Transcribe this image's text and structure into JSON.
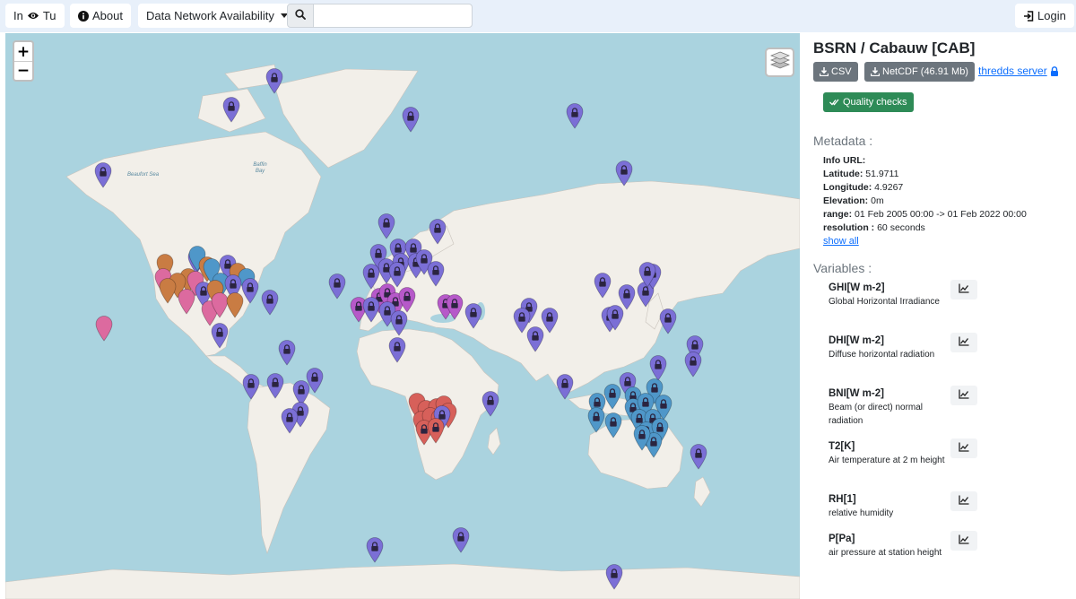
{
  "nav": {
    "logo_prefix": "In",
    "logo_suffix": "Tu",
    "about_label": "About",
    "dropdown_label": "Data Network Availability",
    "search_placeholder": "",
    "login_label": "Login"
  },
  "map": {
    "zoom_in": "+",
    "zoom_out": "−",
    "labels": {
      "beaufort": "Beaufort Sea",
      "baffin": "Baffin Bay"
    },
    "marker_colors": {
      "purple": "#7b6fd6",
      "orange": "#c97c43",
      "pink": "#dc6a9f",
      "blue": "#4f97c9",
      "magenta": "#b659c9",
      "red": "#d7605a"
    },
    "markers": [
      [
        "purple",
        306,
        90,
        true
      ],
      [
        "purple",
        258,
        122,
        true
      ],
      [
        "purple",
        458,
        133,
        true
      ],
      [
        "purple",
        641,
        129,
        true
      ],
      [
        "purple",
        115,
        195,
        true
      ],
      [
        "purple",
        696,
        193,
        true
      ],
      [
        "purple",
        431,
        252,
        true
      ],
      [
        "purple",
        488,
        258,
        true
      ],
      [
        "orange",
        184,
        297,
        false
      ],
      [
        "purple",
        219,
        291,
        true
      ],
      [
        "blue",
        220,
        288,
        false
      ],
      [
        "purple",
        254,
        298,
        true
      ],
      [
        "orange",
        231,
        300,
        false
      ],
      [
        "blue",
        236,
        302,
        false
      ],
      [
        "orange",
        265,
        307,
        false
      ],
      [
        "blue",
        275,
        313,
        false
      ],
      [
        "orange",
        210,
        313,
        false
      ],
      [
        "pink",
        182,
        313,
        false
      ],
      [
        "orange",
        198,
        318,
        false
      ],
      [
        "pink",
        218,
        316,
        false
      ],
      [
        "blue",
        246,
        318,
        false
      ],
      [
        "purple",
        260,
        320,
        true
      ],
      [
        "orange",
        187,
        324,
        false
      ],
      [
        "pink",
        208,
        336,
        false
      ],
      [
        "purple",
        227,
        328,
        true
      ],
      [
        "orange",
        240,
        326,
        false
      ],
      [
        "purple",
        279,
        324,
        true
      ],
      [
        "purple",
        301,
        337,
        true
      ],
      [
        "pink",
        234,
        349,
        false
      ],
      [
        "pink",
        245,
        340,
        false
      ],
      [
        "orange",
        262,
        340,
        false
      ],
      [
        "pink",
        116,
        366,
        false
      ],
      [
        "purple",
        245,
        374,
        true
      ],
      [
        "purple",
        376,
        319,
        true
      ],
      [
        "purple",
        422,
        286,
        true
      ],
      [
        "purple",
        444,
        280,
        true
      ],
      [
        "purple",
        461,
        280,
        true
      ],
      [
        "purple",
        431,
        302,
        true
      ],
      [
        "purple",
        447,
        296,
        true
      ],
      [
        "purple",
        464,
        296,
        true
      ],
      [
        "purple",
        473,
        292,
        true
      ],
      [
        "purple",
        486,
        305,
        true
      ],
      [
        "purple",
        443,
        306,
        true
      ],
      [
        "purple",
        414,
        308,
        true
      ],
      [
        "magenta",
        423,
        335,
        true
      ],
      [
        "magenta",
        432,
        330,
        true
      ],
      [
        "magenta",
        441,
        340,
        true
      ],
      [
        "magenta",
        454,
        334,
        true
      ],
      [
        "magenta",
        400,
        345,
        true
      ],
      [
        "purple",
        414,
        345,
        true
      ],
      [
        "purple",
        432,
        350,
        true
      ],
      [
        "magenta",
        497,
        342,
        true
      ],
      [
        "magenta",
        507,
        342,
        true
      ],
      [
        "purple",
        528,
        352,
        true
      ],
      [
        "purple",
        445,
        360,
        true
      ],
      [
        "purple",
        443,
        390,
        true
      ],
      [
        "purple",
        590,
        346,
        true
      ],
      [
        "purple",
        582,
        357,
        true
      ],
      [
        "purple",
        613,
        357,
        true
      ],
      [
        "purple",
        597,
        378,
        true
      ],
      [
        "purple",
        672,
        318,
        true
      ],
      [
        "purple",
        699,
        331,
        true
      ],
      [
        "purple",
        720,
        328,
        true
      ],
      [
        "purple",
        728,
        308,
        true
      ],
      [
        "purple",
        722,
        306,
        true
      ],
      [
        "purple",
        680,
        356,
        true
      ],
      [
        "purple",
        686,
        354,
        true
      ],
      [
        "purple",
        745,
        358,
        true
      ],
      [
        "purple",
        775,
        388,
        true
      ],
      [
        "purple",
        773,
        406,
        true
      ],
      [
        "purple",
        734,
        410,
        true
      ],
      [
        "purple",
        320,
        393,
        true
      ],
      [
        "purple",
        351,
        424,
        true
      ],
      [
        "purple",
        280,
        431,
        true
      ],
      [
        "purple",
        307,
        430,
        true
      ],
      [
        "purple",
        336,
        438,
        true
      ],
      [
        "purple",
        335,
        462,
        true
      ],
      [
        "purple",
        323,
        469,
        true
      ],
      [
        "red",
        465,
        452,
        false
      ],
      [
        "red",
        475,
        460,
        false
      ],
      [
        "red",
        487,
        458,
        false
      ],
      [
        "red",
        495,
        455,
        false
      ],
      [
        "red",
        470,
        472,
        false
      ],
      [
        "red",
        480,
        468,
        false
      ],
      [
        "red",
        490,
        470,
        false
      ],
      [
        "red",
        500,
        463,
        false
      ],
      [
        "purple",
        493,
        466,
        true
      ],
      [
        "red",
        473,
        482,
        true
      ],
      [
        "red",
        486,
        480,
        true
      ],
      [
        "purple",
        547,
        450,
        true
      ],
      [
        "purple",
        630,
        431,
        true
      ],
      [
        "blue",
        666,
        452,
        true
      ],
      [
        "blue",
        683,
        442,
        true
      ],
      [
        "purple",
        700,
        429,
        true
      ],
      [
        "blue",
        706,
        445,
        true
      ],
      [
        "blue",
        730,
        436,
        true
      ],
      [
        "blue",
        665,
        468,
        true
      ],
      [
        "blue",
        684,
        474,
        true
      ],
      [
        "blue",
        706,
        458,
        true
      ],
      [
        "blue",
        720,
        452,
        true
      ],
      [
        "blue",
        740,
        454,
        true
      ],
      [
        "blue",
        713,
        470,
        true
      ],
      [
        "blue",
        728,
        470,
        true
      ],
      [
        "blue",
        721,
        484,
        true
      ],
      [
        "blue",
        736,
        480,
        true
      ],
      [
        "blue",
        729,
        496,
        true
      ],
      [
        "blue",
        716,
        488,
        true
      ],
      [
        "purple",
        779,
        509,
        true
      ],
      [
        "purple",
        418,
        613,
        true
      ],
      [
        "purple",
        514,
        602,
        true
      ],
      [
        "purple",
        685,
        643,
        true
      ]
    ]
  },
  "panel": {
    "station_title": "BSRN / Cabauw [CAB]",
    "csv_label": "CSV",
    "netcdf_label": "NetCDF (46.91 Mb)",
    "thredds_label": "thredds server",
    "quality_label": "Quality checks",
    "metadata_heading": "Metadata :",
    "meta": {
      "info_url_label": "Info URL:",
      "latitude_label": "Latitude:",
      "latitude": "51.9711",
      "longitude_label": "Longitude:",
      "longitude": "4.9267",
      "elevation_label": "Elevation:",
      "elevation": "0m",
      "range_label": "range:",
      "range": "01 Feb 2005 00:00 -> 01 Feb 2022 00:00",
      "resolution_label": "resolution :",
      "resolution": "60 seconds",
      "show_all": "show all"
    },
    "variables_heading": "Variables :",
    "variables": [
      {
        "name": "GHI[W m-2]",
        "desc": "Global Horizontal Irradiance"
      },
      {
        "name": "DHI[W m-2]",
        "desc": "Diffuse horizontal radiation"
      },
      {
        "name": "BNI[W m-2]",
        "desc": "Beam (or direct) normal radiation"
      },
      {
        "name": "T2[K]",
        "desc": "Air temperature at 2 m height"
      },
      {
        "name": "RH[1]",
        "desc": "relative humidity"
      },
      {
        "name": "P[Pa]",
        "desc": "air pressure at station height"
      }
    ]
  }
}
